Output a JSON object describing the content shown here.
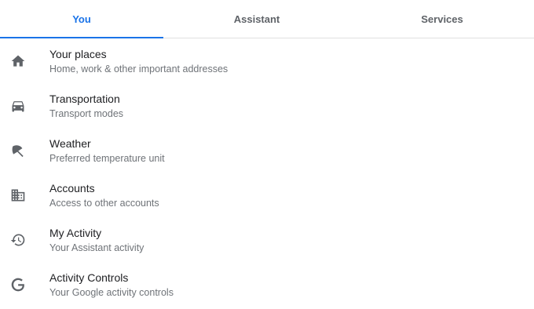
{
  "tabs": [
    {
      "label": "You",
      "active": true
    },
    {
      "label": "Assistant",
      "active": false
    },
    {
      "label": "Services",
      "active": false
    }
  ],
  "items": [
    {
      "icon": "home-icon",
      "title": "Your places",
      "subtitle": "Home, work & other important addresses"
    },
    {
      "icon": "car-icon",
      "title": "Transportation",
      "subtitle": "Transport modes"
    },
    {
      "icon": "weather-icon",
      "title": "Weather",
      "subtitle": "Preferred temperature unit"
    },
    {
      "icon": "building-icon",
      "title": "Accounts",
      "subtitle": "Access to other accounts"
    },
    {
      "icon": "history-icon",
      "title": "My Activity",
      "subtitle": "Your Assistant activity"
    },
    {
      "icon": "google-icon",
      "title": "Activity Controls",
      "subtitle": "Your Google activity controls"
    }
  ],
  "colors": {
    "accent": "#1a73e8",
    "icon": "#5f6368",
    "text": "#202124",
    "subtext": "#6f7378",
    "divider": "#e0e0e0"
  }
}
